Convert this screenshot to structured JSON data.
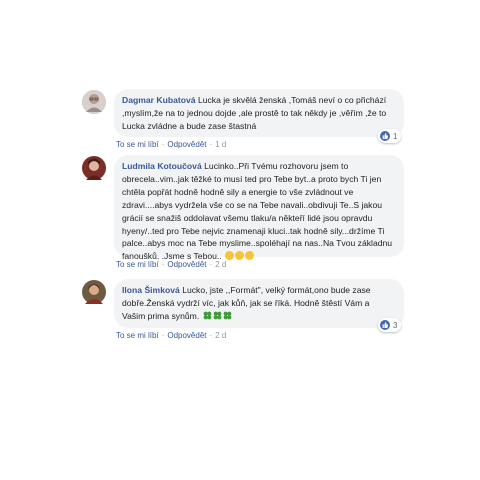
{
  "comments": [
    {
      "author": "Dagmar Kubatová",
      "text": "Lucka je skvělá ženská ,Tomáš neví o co přichází ,myslím,že na to jednou dojde ,ale prostě to tak někdy je ,věřím ,že to Lucka zvládne a bude zase štastná",
      "like_label": "To se mi líbí",
      "reply_label": "Odpovědět",
      "time": "1 d",
      "reaction_count": "1",
      "icons": [
        "avatar-woman-glasses",
        "like-icon"
      ]
    },
    {
      "author": "Ludmila Kotoučová",
      "text": "Lucinko..Při Tvému rozhovoru jsem to obrecela..vim..jak těžké to musí ted pro Tebe byt..a proto bych Ti jen chtěla popřát hodně hodně sily a energie to vše zvládnout ve zdravi....abys vydržela vše co se na Tebe navali..obdivuji Te..S jakou grácií se snažiš oddolavat všemu tlaku/a někteří lidé jsou opravdu hyeny/..ted pro Tebe nejvic znamenaji kluci..tak hodně sily...držíme Ti palce..abys moc na Tebe myslime..spoléhají na nas..Na Tvou základnu fanoušků. .Jsme s Tebou..",
      "emojis": [
        "grinning-face",
        "grinning-face",
        "grinning-face"
      ],
      "like_label": "To se mi líbí",
      "reply_label": "Odpovědět",
      "time": "2 d",
      "icons": [
        "avatar-woman-dark-hair",
        "grinning-face-icon"
      ]
    },
    {
      "author": "Ilona Šimková",
      "text": "Lucko, jste ,,Formát\", velký formát,ono bude zase dobře.Ženská vydrží víc, jak kůň, jak se říká. Hodně štěstí Vám a Vašim prima synům.",
      "emojis": [
        "four-leaf-clover",
        "four-leaf-clover",
        "four-leaf-clover"
      ],
      "like_label": "To se mi líbí",
      "reply_label": "Odpovědět",
      "time": "2 d",
      "reaction_count": "3",
      "icons": [
        "avatar-woman-outdoor",
        "clover-icon",
        "like-icon"
      ]
    }
  ],
  "colors": {
    "name": "#385898",
    "bubble": "#f2f3f5",
    "like": "#4267b2"
  }
}
